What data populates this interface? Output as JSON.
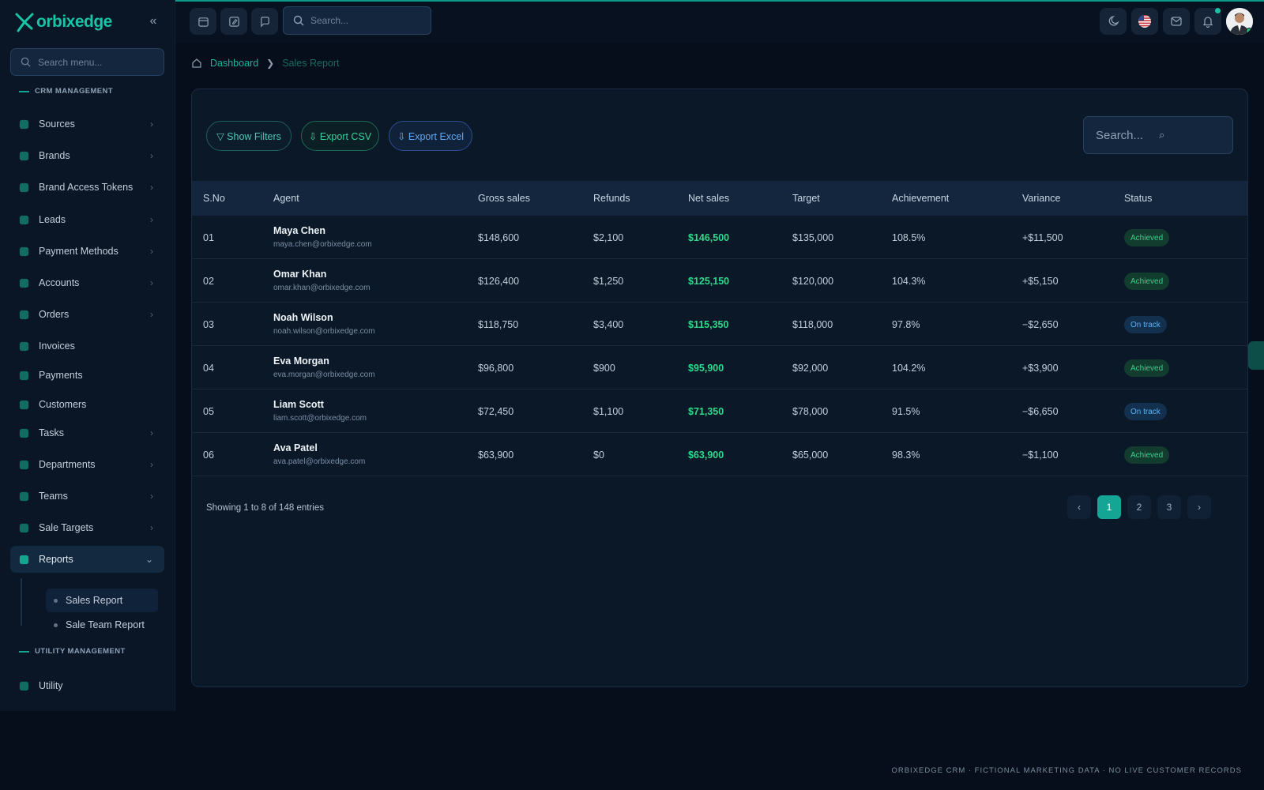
{
  "brand": {
    "name": "orbixedge"
  },
  "sidebar": {
    "search_placeholder": "Search menu...",
    "section_crm": "CRM MANAGEMENT",
    "section_utility": "UTILITY MANAGEMENT",
    "items": [
      {
        "label": "Sources",
        "icon": "sources-icon",
        "has_children": true
      },
      {
        "label": "Brands",
        "icon": "tag-icon",
        "has_children": true
      },
      {
        "label": "Brand Access Tokens",
        "icon": "lock-icon",
        "has_children": true
      },
      {
        "label": "Leads",
        "icon": "funnel-icon",
        "has_children": true
      },
      {
        "label": "Payment Methods",
        "icon": "wallet-icon",
        "has_children": true
      },
      {
        "label": "Accounts",
        "icon": "bank-icon",
        "has_children": true
      },
      {
        "label": "Orders",
        "icon": "cart-icon",
        "has_children": true
      },
      {
        "label": "Invoices",
        "icon": "invoice-icon",
        "has_children": false
      },
      {
        "label": "Payments",
        "icon": "coin-icon",
        "has_children": false
      },
      {
        "label": "Customers",
        "icon": "users-icon",
        "has_children": false
      },
      {
        "label": "Tasks",
        "icon": "tasks-icon",
        "has_children": true
      },
      {
        "label": "Departments",
        "icon": "departments-icon",
        "has_children": true
      },
      {
        "label": "Teams",
        "icon": "team-icon",
        "has_children": true
      },
      {
        "label": "Sale Targets",
        "icon": "chart-icon",
        "has_children": true
      },
      {
        "label": "Reports",
        "icon": "pie-chart-icon",
        "has_children": true,
        "active": true
      }
    ],
    "sub_items": [
      {
        "label": "Sales Report",
        "active": true
      },
      {
        "label": "Sale Team Report",
        "active": false
      }
    ],
    "utility_items": [
      {
        "label": "Utility",
        "icon": "utility-icon"
      }
    ]
  },
  "topbar": {
    "search_placeholder": "Search...",
    "notifications_unread": true
  },
  "breadcrumb": {
    "home": "Dashboard",
    "current": "Sales Report"
  },
  "toolbar": {
    "filters_label": "▽ Show Filters",
    "csv_label": "⇩ Export CSV",
    "excel_label": "⇩ Export Excel",
    "search_placeholder": "Search..."
  },
  "table": {
    "columns": [
      "S.No",
      "Agent",
      "Gross sales",
      "Refunds",
      "Net sales",
      "Target",
      "Achievement",
      "Variance",
      "Status"
    ],
    "rows": [
      {
        "sno": "01",
        "name": "Maya Chen",
        "email": "maya.chen@orbixedge.com",
        "gross": "$148,600",
        "refunds": "$2,100",
        "net": "$146,500",
        "target": "$135,000",
        "achievement": "108.5%",
        "variance": "+$11,500",
        "status": "Achieved"
      },
      {
        "sno": "02",
        "name": "Omar Khan",
        "email": "omar.khan@orbixedge.com",
        "gross": "$126,400",
        "refunds": "$1,250",
        "net": "$125,150",
        "target": "$120,000",
        "achievement": "104.3%",
        "variance": "+$5,150",
        "status": "Achieved"
      },
      {
        "sno": "03",
        "name": "Noah Wilson",
        "email": "noah.wilson@orbixedge.com",
        "gross": "$118,750",
        "refunds": "$3,400",
        "net": "$115,350",
        "target": "$118,000",
        "achievement": "97.8%",
        "variance": "−$2,650",
        "status": "On track"
      },
      {
        "sno": "04",
        "name": "Eva Morgan",
        "email": "eva.morgan@orbixedge.com",
        "gross": "$96,800",
        "refunds": "$900",
        "net": "$95,900",
        "target": "$92,000",
        "achievement": "104.2%",
        "variance": "+$3,900",
        "status": "Achieved"
      },
      {
        "sno": "05",
        "name": "Liam Scott",
        "email": "liam.scott@orbixedge.com",
        "gross": "$72,450",
        "refunds": "$1,100",
        "net": "$71,350",
        "target": "$78,000",
        "achievement": "91.5%",
        "variance": "−$6,650",
        "status": "On track"
      },
      {
        "sno": "06",
        "name": "Ava Patel",
        "email": "ava.patel@orbixedge.com",
        "gross": "$63,900",
        "refunds": "$0",
        "net": "$63,900",
        "target": "$65,000",
        "achievement": "98.3%",
        "variance": "−$1,100",
        "status": "Achieved"
      }
    ]
  },
  "pagination": {
    "info": "Showing 1 to 8 of 148 entries",
    "prev": "‹",
    "next": "›",
    "pages": [
      "1",
      "2",
      "3"
    ],
    "current": "1"
  },
  "footer": {
    "disclaimer": "ORBIXEDGE CRM · FICTIONAL MARKETING DATA · NO LIVE CUSTOMER RECORDS"
  },
  "colors": {
    "accent": "#15b79d",
    "net_sales": "#2fd88b",
    "achieved_bg": "#123c2e",
    "ontrack_bg": "#13304f",
    "background": "#050e1a"
  }
}
